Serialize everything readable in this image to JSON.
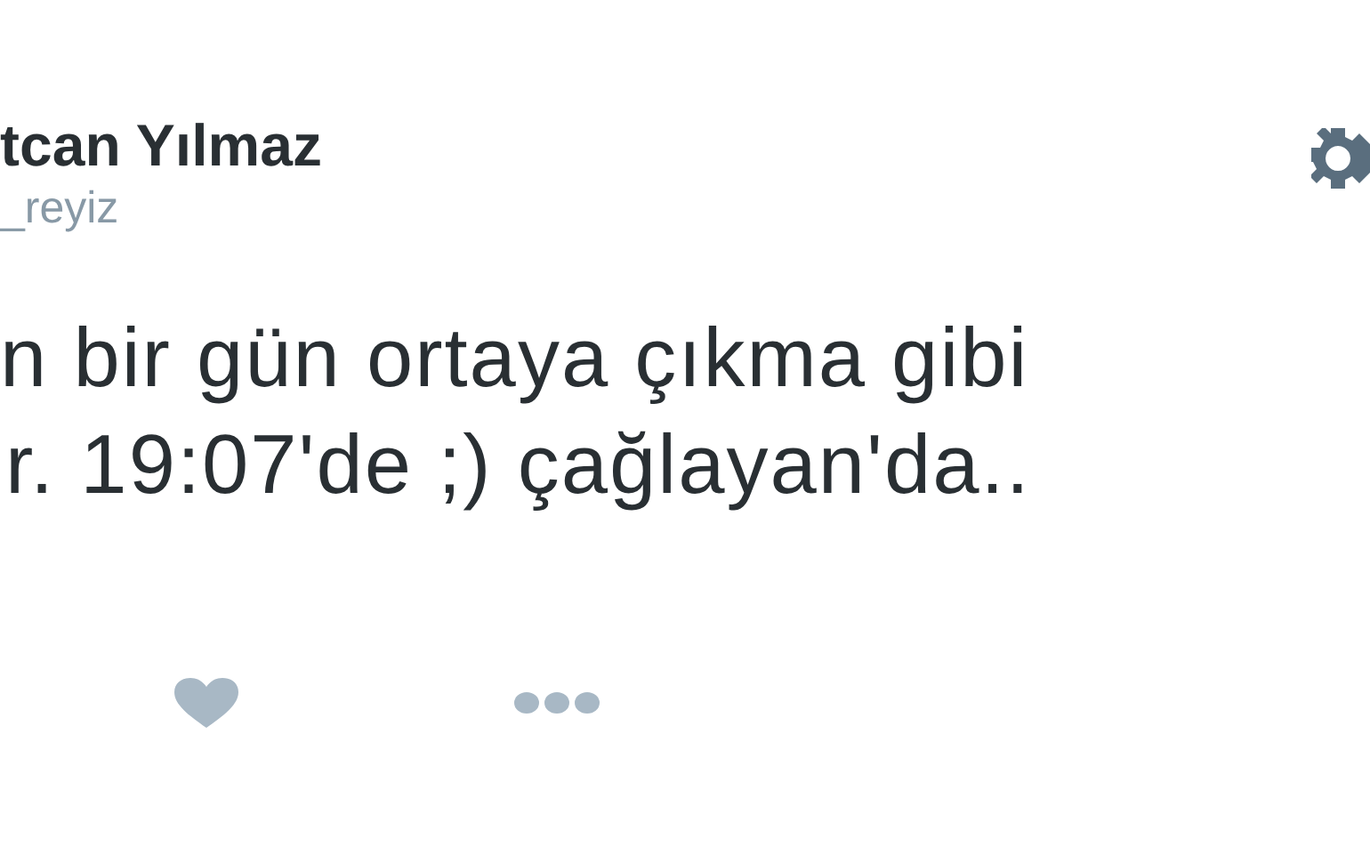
{
  "tweet": {
    "author_name": "tcan Yılmaz",
    "author_handle": "_reyiz",
    "text_lines": [
      "n bir gün ortaya çıkma gibi",
      "r. 19:07'de ;) çağlayan'da.."
    ]
  }
}
